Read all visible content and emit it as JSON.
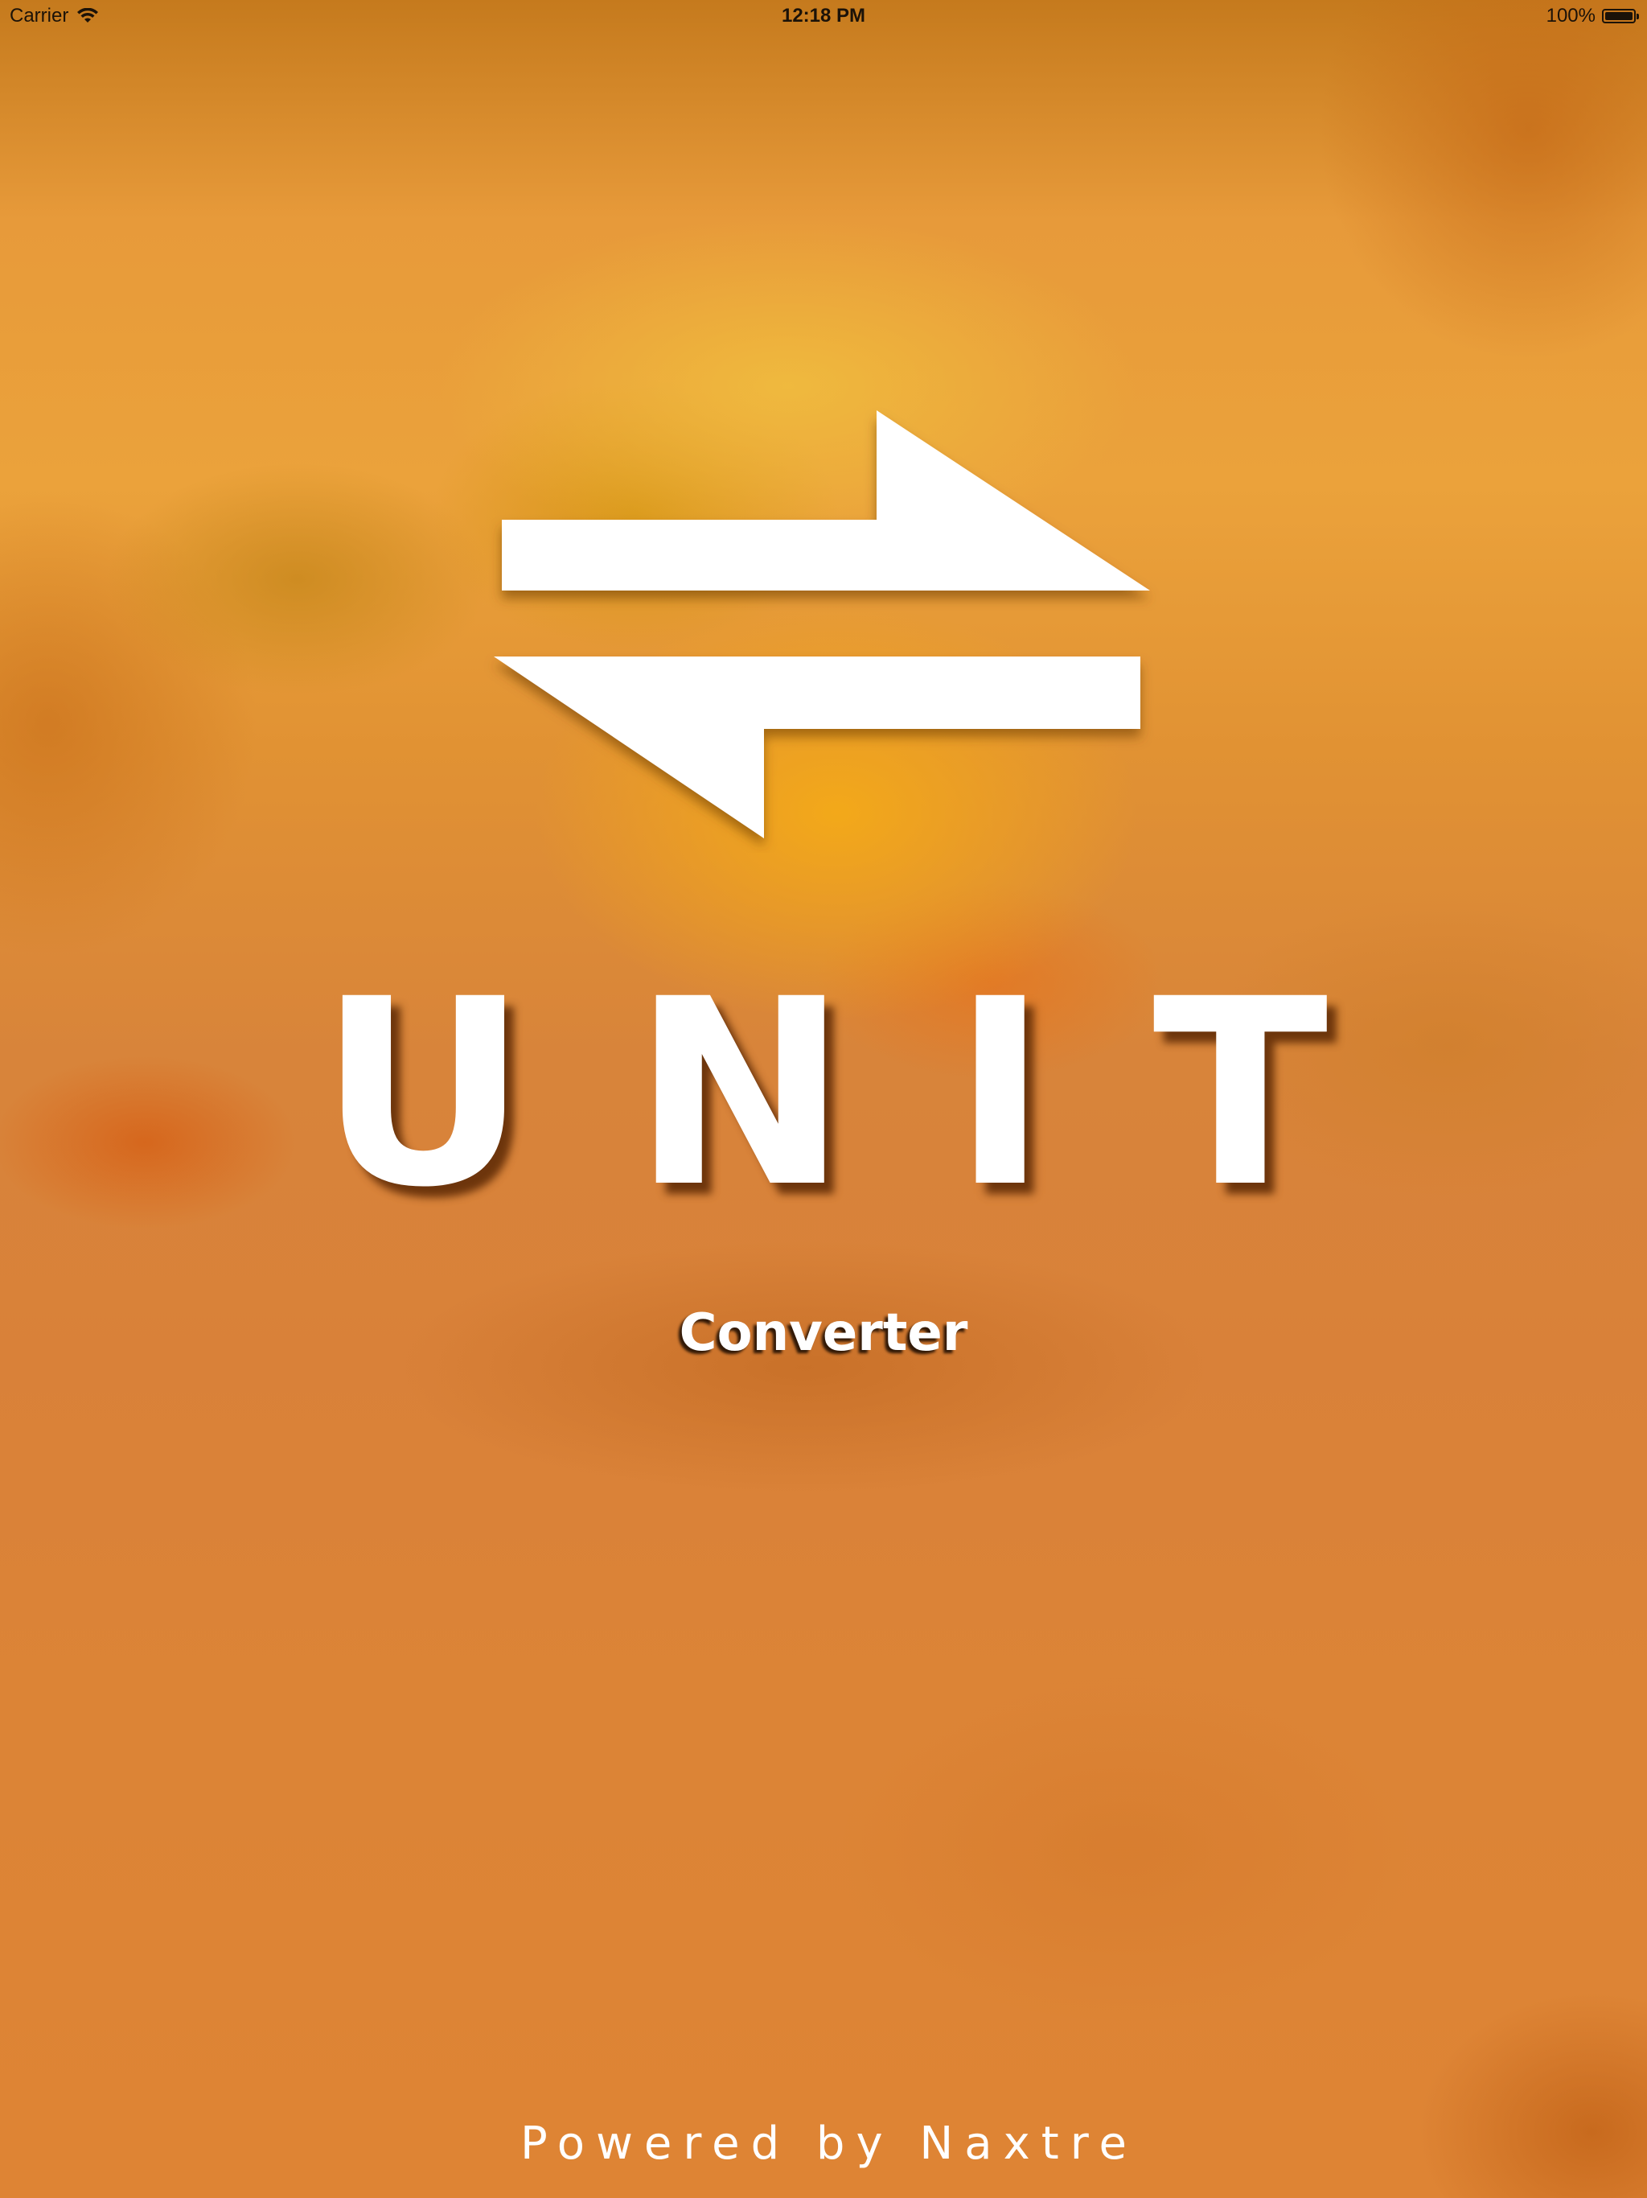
{
  "status_bar": {
    "carrier": "Carrier",
    "time": "12:18 PM",
    "battery": "100%",
    "battery_level": 1.0,
    "icons": [
      "wifi-icon",
      "battery-icon"
    ]
  },
  "splash": {
    "title": "UNIT",
    "subtitle": "Converter",
    "footer": "Powered by Naxtre",
    "logo_icon": "swap-arrows-icon"
  },
  "colors": {
    "background_main": "#de8434",
    "background_highlight": "#f4aa18",
    "text": "#ffffff",
    "status_text": "#1b1208"
  }
}
